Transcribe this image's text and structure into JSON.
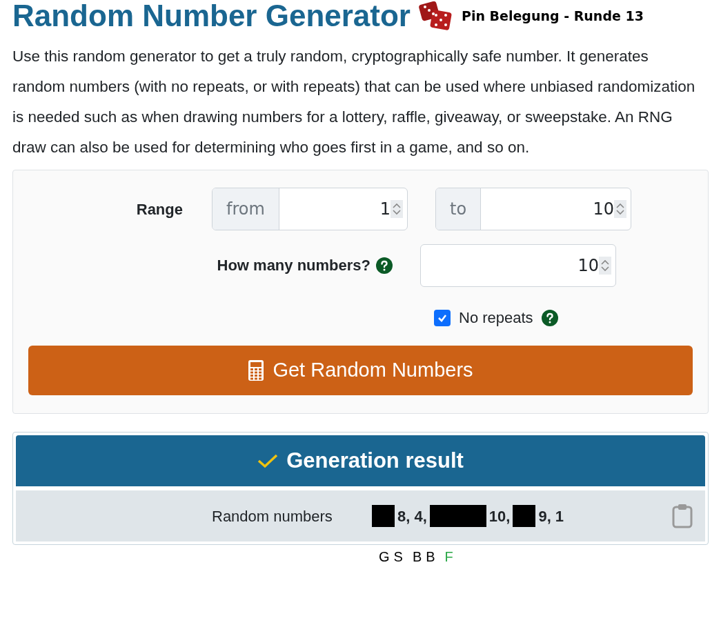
{
  "title": "Random Number Generator",
  "badge": "Pin Belegung - Runde 13",
  "intro": "Use this random generator to get a truly random, cryptographically safe number. It generates random numbers (with no repeats, or with repeats) that can be used where unbiased randomization is needed such as when drawing numbers for a lottery, raffle, giveaway, or sweepstake. An RNG draw can also be used for determining who goes first in a game, and so on.",
  "form": {
    "range_label": "Range",
    "from": {
      "addon": "from",
      "value": "1"
    },
    "to": {
      "addon": "to",
      "value": "10"
    },
    "count_label": "How many numbers?",
    "count": {
      "value": "10"
    },
    "no_repeats": {
      "label": "No repeats",
      "checked": true
    },
    "button": "Get Random Numbers"
  },
  "result": {
    "header": "Generation result",
    "label": "Random numbers",
    "segments": [
      {
        "kind": "redacted_short"
      },
      {
        "kind": "text",
        "text": "8, 4,"
      },
      {
        "kind": "redacted_long"
      },
      {
        "kind": "text",
        "text": "10,"
      },
      {
        "kind": "redacted_short"
      },
      {
        "kind": "text",
        "text": "9, 1"
      }
    ]
  },
  "legend": [
    {
      "text": "G",
      "color": "#000000"
    },
    {
      "text": "S",
      "color": "#000000"
    },
    {
      "text": "B",
      "color": "#000000"
    },
    {
      "text": "B",
      "color": "#000000"
    },
    {
      "text": "F",
      "color": "#28a745"
    }
  ]
}
